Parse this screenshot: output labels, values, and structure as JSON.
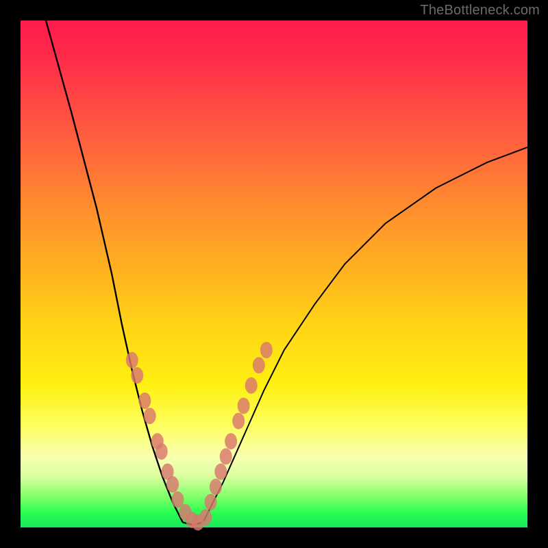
{
  "watermark": "TheBottleneck.com",
  "chart_data": {
    "type": "line",
    "title": "",
    "xlabel": "",
    "ylabel": "",
    "xlim": [
      0,
      100
    ],
    "ylim": [
      0,
      100
    ],
    "grid": false,
    "legend": false,
    "series": [
      {
        "name": "left-curve",
        "x": [
          5,
          10,
          15,
          18,
          20,
          22,
          24,
          26,
          28,
          30,
          32
        ],
        "values": [
          100,
          82,
          63,
          50,
          40,
          31,
          23,
          16,
          10,
          5,
          1
        ]
      },
      {
        "name": "valley-floor",
        "x": [
          32,
          34,
          36
        ],
        "values": [
          1,
          0.5,
          1
        ]
      },
      {
        "name": "right-curve",
        "x": [
          36,
          40,
          44,
          48,
          52,
          58,
          64,
          72,
          82,
          92,
          100
        ],
        "values": [
          1,
          9,
          18,
          27,
          35,
          44,
          52,
          60,
          67,
          72,
          75
        ]
      },
      {
        "name": "left-dots",
        "type": "scatter",
        "x": [
          22,
          23,
          24.5,
          25.5,
          27,
          27.8,
          29,
          30,
          31,
          32.5,
          33.8,
          35
        ],
        "values": [
          33,
          30,
          25,
          22,
          17,
          15,
          11,
          8.5,
          5.5,
          3,
          1.5,
          1
        ]
      },
      {
        "name": "right-dots",
        "type": "scatter",
        "x": [
          36.5,
          37.5,
          38.5,
          39.5,
          40.5,
          41.5,
          43,
          44,
          45.5,
          47,
          48.5
        ],
        "values": [
          2,
          5,
          8,
          11,
          14,
          17,
          21,
          24,
          28,
          32,
          35
        ]
      }
    ],
    "annotations": [],
    "colors": {
      "curve": "#000000",
      "dots": "#d9776e",
      "background_top": "#ff1a4d",
      "background_bottom": "#18e85a",
      "frame": "#000000"
    }
  }
}
